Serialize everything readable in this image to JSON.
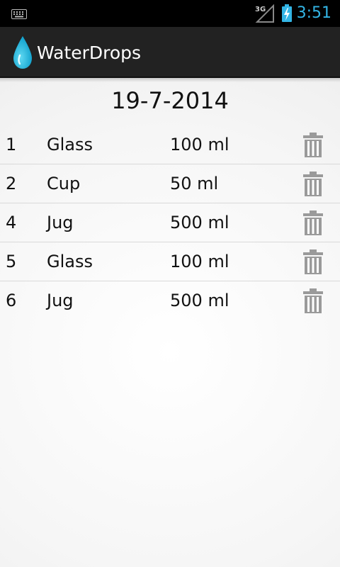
{
  "status_bar": {
    "network": "3G",
    "time": "3:51"
  },
  "icons": {
    "keyboard": "keyboard-icon",
    "signal": "signal-icon",
    "battery": "battery-charging-icon",
    "app": "water-drop-icon",
    "delete": "trash-icon"
  },
  "colors": {
    "accent": "#33b5e5",
    "action_bar": "#222222",
    "trash": "#9a9a9a"
  },
  "app": {
    "title": "WaterDrops"
  },
  "date": "19-7-2014",
  "entries": [
    {
      "id": "1",
      "vessel": "Glass",
      "volume": "100 ml"
    },
    {
      "id": "2",
      "vessel": "Cup",
      "volume": "50 ml"
    },
    {
      "id": "4",
      "vessel": "Jug",
      "volume": "500 ml"
    },
    {
      "id": "5",
      "vessel": "Glass",
      "volume": "100 ml"
    },
    {
      "id": "6",
      "vessel": "Jug",
      "volume": "500 ml"
    }
  ]
}
